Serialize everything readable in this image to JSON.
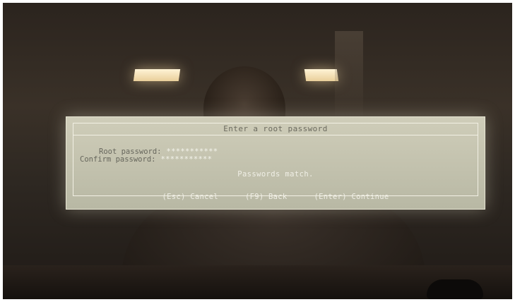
{
  "dialog": {
    "title": "Enter a root password",
    "fields": [
      {
        "label": "Root password:",
        "value": "***********"
      },
      {
        "label": "Confirm password:",
        "value": "***********"
      }
    ],
    "status": "Passwords match.",
    "actions": {
      "cancel": "(Esc) Cancel",
      "back": "(F9) Back",
      "continue": "(Enter) Continue"
    }
  },
  "colors": {
    "dialog_background": "#c4c3ae",
    "dialog_text": "#66665c",
    "highlight_text": "#f4f4ec"
  }
}
